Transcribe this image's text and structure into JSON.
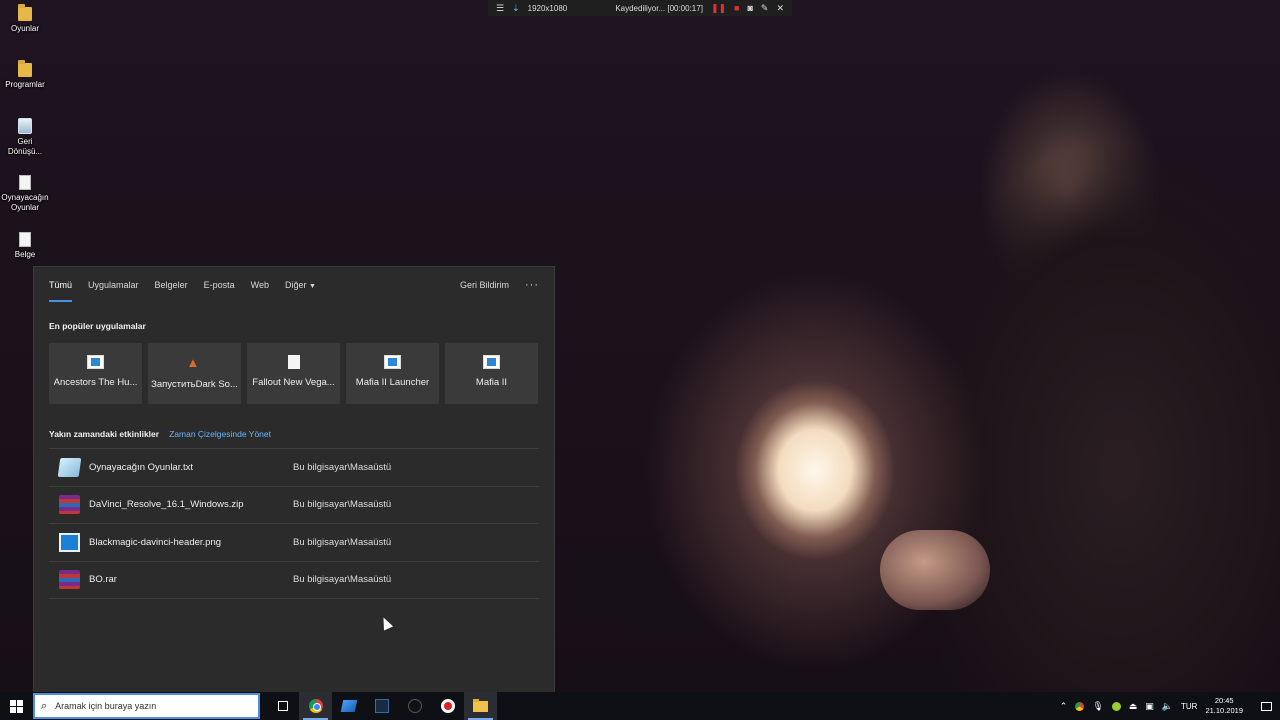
{
  "desktop": {
    "icons": [
      {
        "label": "Oyunlar",
        "type": "folder"
      },
      {
        "label": "Programlar",
        "type": "folder"
      },
      {
        "label": "Geri Dönüşü...",
        "type": "recycle-bin"
      },
      {
        "label": "Oynayacağın Oyunlar",
        "type": "document"
      },
      {
        "label": "Belge",
        "type": "document"
      }
    ]
  },
  "recorder": {
    "resolution": "1920x1080",
    "status": "Kaydediliyor... [00:00:17]"
  },
  "search_panel": {
    "tabs": [
      "Tümü",
      "Uygulamalar",
      "Belgeler",
      "E-posta",
      "Web",
      "Diğer"
    ],
    "active_tab": "Tümü",
    "feedback_label": "Geri Bildirim",
    "popular_title": "En popüler uygulamalar",
    "popular_apps": [
      {
        "label": "Ancestors The Hu...",
        "icon": "window-app-icon"
      },
      {
        "label": "ЗапуститьDark So...",
        "icon": "fire-icon"
      },
      {
        "label": "Fallout New Vega...",
        "icon": "page-icon"
      },
      {
        "label": "Mafia II Launcher",
        "icon": "window-app-icon"
      },
      {
        "label": "Mafia II",
        "icon": "window-app-icon"
      }
    ],
    "recent_title": "Yakın zamandaki etkinlikler",
    "manage_timeline": "Zaman Çizelgesinde Yönet",
    "recent_items": [
      {
        "name": "Oynayacağın Oyunlar.txt",
        "location": "Bu bilgisayar\\Masaüstü",
        "icon": "text-file-icon"
      },
      {
        "name": "DaVinci_Resolve_16.1_Windows.zip",
        "location": "Bu bilgisayar\\Masaüstü",
        "icon": "winrar-icon"
      },
      {
        "name": "Blackmagic-davinci-header.png",
        "location": "Bu bilgisayar\\Masaüstü",
        "icon": "image-file-icon"
      },
      {
        "name": "BO.rar",
        "location": "Bu bilgisayar\\Masaüstü",
        "icon": "winrar-icon"
      }
    ]
  },
  "taskbar": {
    "search_placeholder": "Aramak için buraya yazın",
    "language": "TUR",
    "time": "20:45",
    "date": "21.10.2019"
  },
  "colors": {
    "accent": "#4a90e2",
    "link": "#6ab4ff",
    "panel_bg": "#2b2b2b",
    "tile_bg": "#3a3a3a"
  }
}
